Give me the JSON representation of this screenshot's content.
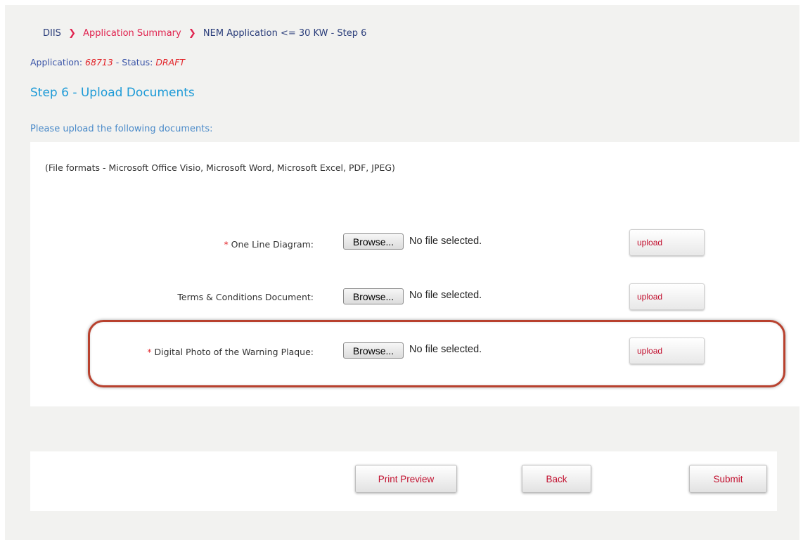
{
  "breadcrumb": {
    "root": "DIIS",
    "separator": "❯",
    "summary": "Application Summary",
    "current": "NEM Application <= 30 KW - Step 6"
  },
  "application": {
    "label": "Application:",
    "number": "68713",
    "dash": "-",
    "status_label": "Status:",
    "status": "DRAFT"
  },
  "page_title": "Step 6 - Upload Documents",
  "instruction": "Please upload the following documents:",
  "file_formats": "(File formats - Microsoft Office Visio, Microsoft Word, Microsoft Excel, PDF, JPEG)",
  "documents": [
    {
      "required_mark": "*",
      "label": "One Line Diagram:",
      "browse": "Browse...",
      "file_status": "No file selected.",
      "upload": "upload"
    },
    {
      "required_mark": "",
      "label": "Terms & Conditions Document:",
      "browse": "Browse...",
      "file_status": "No file selected.",
      "upload": "upload"
    },
    {
      "required_mark": "*",
      "label": "Digital Photo of the Warning Plaque:",
      "browse": "Browse...",
      "file_status": "No file selected.",
      "upload": "upload"
    }
  ],
  "footer": {
    "print_preview": "Print Preview",
    "back": "Back",
    "submit": "Submit"
  },
  "colors": {
    "accent_red": "#e3262b",
    "title_blue": "#1e9bd7",
    "highlight_border": "#b8412e"
  }
}
